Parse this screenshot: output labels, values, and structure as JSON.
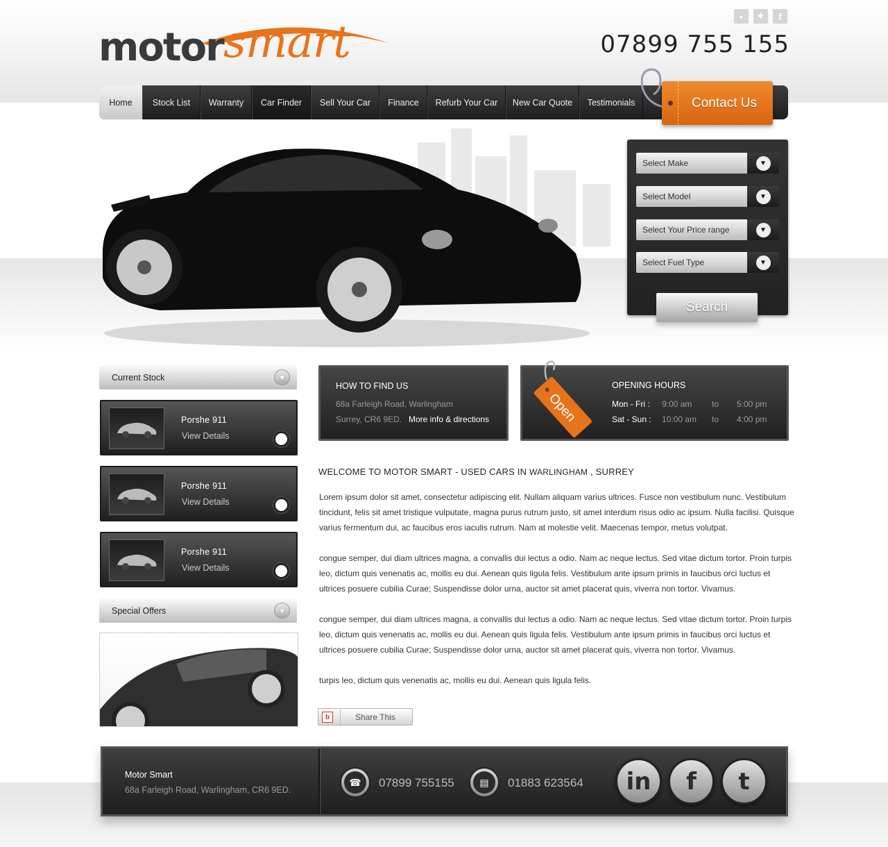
{
  "brand": {
    "word1": "motor",
    "word2": "smart",
    "accent": "#e8731a"
  },
  "header": {
    "phone": "07899 755 155",
    "social_icons": [
      "myspace-icon",
      "twitter-icon",
      "facebook-icon"
    ]
  },
  "nav": {
    "items": [
      "Home",
      "Stock List",
      "Warranty",
      "Car Finder",
      "Sell Your Car",
      "Finance",
      "Refurb Your Car",
      "New Car Quote",
      "Testimonials"
    ],
    "active": "Home",
    "contact_label": "Contact Us"
  },
  "finder": {
    "selects": [
      "Select Make",
      "Select Model",
      "Select Your Price range",
      "Select Fuel Type"
    ],
    "search_label": "Search"
  },
  "sidebar": {
    "current_stock_label": "Current Stock",
    "stock": [
      {
        "title": "Porshe 911",
        "link": "View Details"
      },
      {
        "title": "Porshe 911",
        "link": "View Details"
      },
      {
        "title": "Porshe 911",
        "link": "View Details"
      }
    ],
    "special_offers_label": "Special Offers"
  },
  "find_us": {
    "title": "HOW TO FIND US",
    "line1": "68a Farleigh Road, Warlingham",
    "line2": "Surrey, CR6 9ED.",
    "link": "More info & directions"
  },
  "hours": {
    "tag": "Open",
    "title": "OPENING HOURS",
    "rows": [
      {
        "days": "Mon - Fri :",
        "open": "9:00 am",
        "to": "to",
        "close": "5:00 pm"
      },
      {
        "days": "Sat - Sun :",
        "open": "10:00 am",
        "to": "to",
        "close": "4:00 pm"
      }
    ]
  },
  "content": {
    "welcome_main": "WELCOME TO MOTOR SMART - USED CARS IN ",
    "welcome_place": "WARLINGHAM",
    "welcome_end": " , SURREY",
    "paragraphs": [
      "Lorem ipsum dolor sit amet, consectetur adipiscing elit. Nullam aliquam varius ultrices. Fusce non vestibulum nunc. Vestibulum tincidunt, felis sit amet tristique vulputate, magna purus rutrum justo, sit amet interdum risus odio ac ipsum. Nulla facilisi. Quisque varius fermentum dui, ac faucibus eros iaculis rutrum. Nam at molestie velit. Maecenas tempor, metus volutpat.",
      "congue semper, dui diam ultrices magna, a convallis dui lectus a odio. Nam ac neque lectus. Sed vitae dictum tortor. Proin turpis leo, dictum quis venenatis ac, mollis eu dui. Aenean quis ligula felis. Vestibulum ante ipsum primis in faucibus orci luctus et ultrices posuere cubilia Curae; Suspendisse dolor urna, auctor sit amet placerat quis, viverra non tortor. Vivamus.",
      "congue semper, dui diam ultrices magna, a convallis dui lectus a odio. Nam ac neque lectus. Sed vitae dictum tortor. Proin turpis leo, dictum quis venenatis ac, mollis eu dui. Aenean quis ligula felis. Vestibulum ante ipsum primis in faucibus orci luctus et ultrices posuere cubilia Curae; Suspendisse dolor urna, auctor sit amet placerat quis, viverra non tortor. Vivamus.",
      "turpis leo, dictum quis venenatis ac, mollis eu dui. Aenean quis ligula felis."
    ],
    "share_label": "Share This"
  },
  "footer": {
    "name": "Motor Smart",
    "address": "68a Farleigh Road, Warlingham, CR6 9ED.",
    "phone": "07899 755155",
    "fax": "01883 623564",
    "social": [
      "linkedin-icon",
      "facebook-icon",
      "twitter-icon"
    ]
  }
}
